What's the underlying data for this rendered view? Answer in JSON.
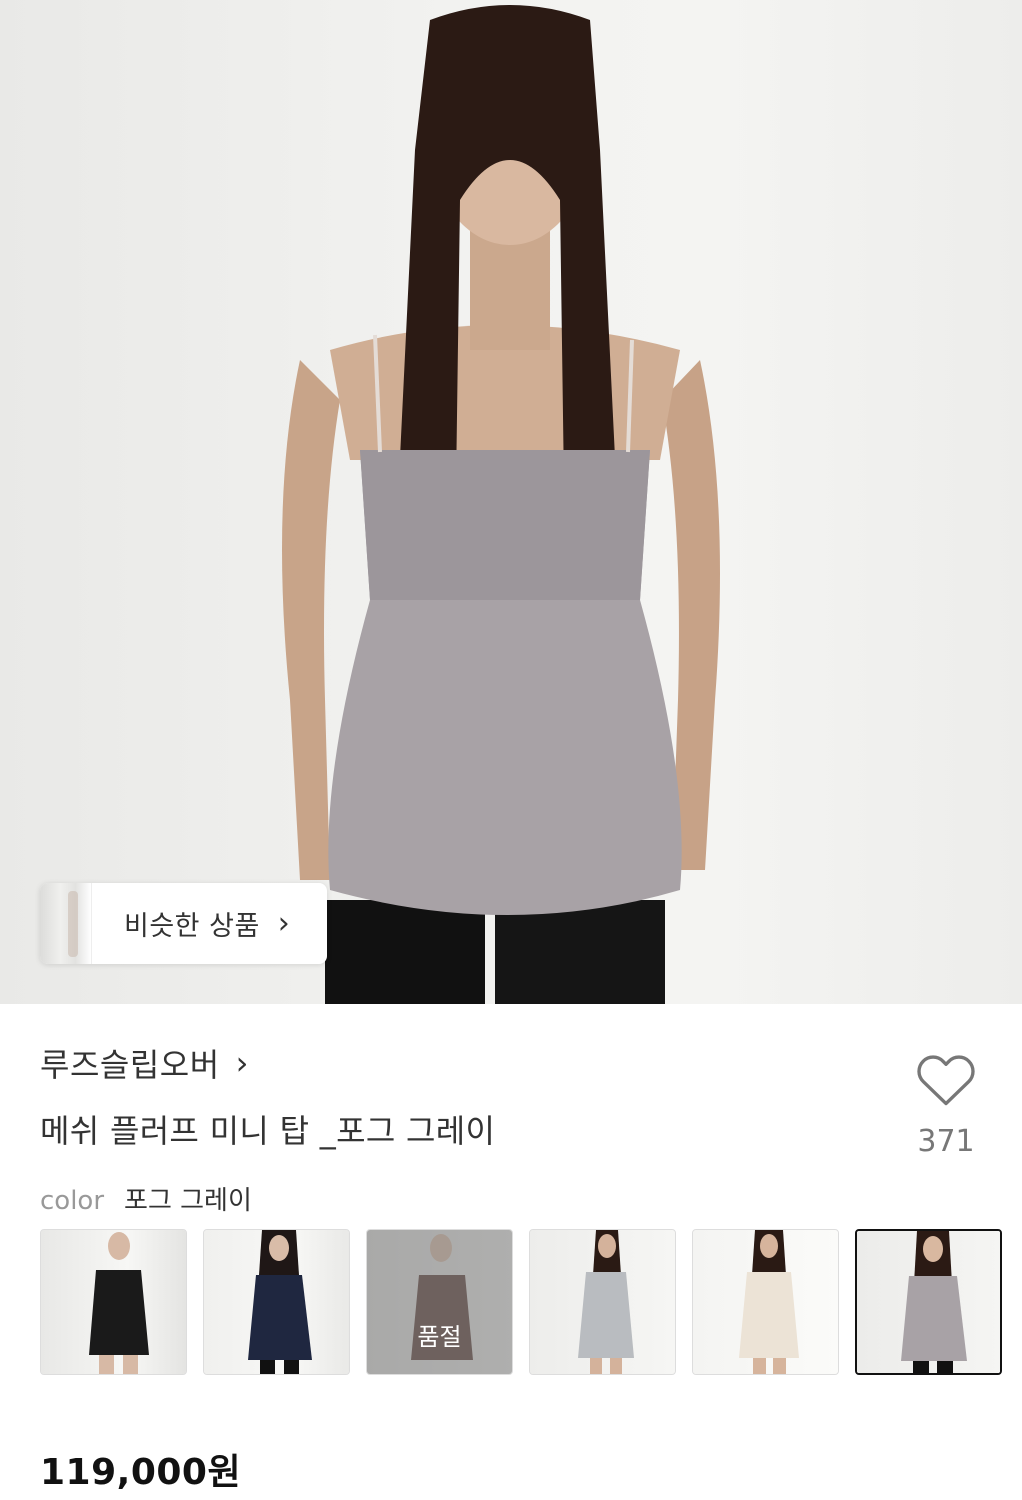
{
  "similar": {
    "label": "비슷한 상품"
  },
  "brand": {
    "name": "루즈슬립오버"
  },
  "product": {
    "name": "메쉬 플러프 미니 탑 _포그 그레이",
    "price": "119,000원"
  },
  "like": {
    "count": "371"
  },
  "color": {
    "label": "color",
    "selected": "포그 그레이",
    "options": [
      {
        "key": "black",
        "soldout": false
      },
      {
        "key": "navy",
        "soldout": false
      },
      {
        "key": "brown",
        "soldout": true,
        "soldout_label": "품절"
      },
      {
        "key": "light-gray",
        "soldout": false
      },
      {
        "key": "cream",
        "soldout": false
      },
      {
        "key": "fog-gray",
        "soldout": false,
        "selected": true
      }
    ]
  },
  "colors": {
    "text_primary": "#333333",
    "text_muted": "#999999",
    "price": "#111111",
    "selected_border": "#111111"
  }
}
